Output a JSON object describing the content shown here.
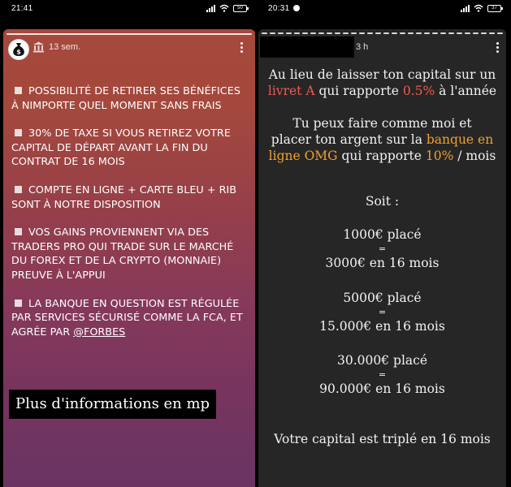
{
  "left_phone": {
    "status_time": "21:41",
    "battery": "50",
    "story_time": "13 sem.",
    "bullets": [
      "POSSIBILITÉ DE RETIRER SES BÉNÉFICES À NIMPORTE QUEL MOMENT SANS FRAIS",
      "30% DE TAXE SI VOUS RETIREZ VOTRE CAPITAL DE DÉPART AVANT LA FIN DU CONTRAT DE 16 MOIS",
      "COMPTE EN LIGNE + CARTE BLEU + RIB SONT À NOTRE DISPOSITION",
      "VOS GAINS PROVIENNENT VIA DES TRADERS PRO QUI TRADE SUR LE MARCHÉ DU FOREX ET DE LA CRYPTO (MONNAIE) PREUVE À L'APPUI",
      "LA BANQUE EN QUESTION EST RÉGULÉE PAR SERVICES SÉCURISÉ COMME LA FCA, ET AGRÉE PAR "
    ],
    "mention": "@FORBES",
    "cta": "Plus d'informations en mp",
    "colors": {
      "gradient_top": "#a4493b",
      "gradient_bottom": "#6a3462"
    }
  },
  "right_phone": {
    "status_time": "20:31",
    "battery": "37",
    "story_time": "3 h",
    "p1": {
      "a": "Au lieu de laisser ton capital sur un",
      "b1": "livret A",
      "b2": " qui rapporte ",
      "b3": "0.5%",
      "b4": " à l'année"
    },
    "p2": {
      "a": "Tu peux faire comme moi et",
      "b1": "placer ton argent sur la ",
      "b2": "banque en",
      "c1": "ligne OMG",
      "c2": " qui rapporte ",
      "c3": "10%",
      "c4": " / mois"
    },
    "soit": "Soit :",
    "examples": [
      {
        "placed": "1000€ placé",
        "eq": "=",
        "result": "3000€ en 16 mois"
      },
      {
        "placed": "5000€ placé",
        "eq": "=",
        "result": "15.000€ en 16 mois"
      },
      {
        "placed": "30.000€ placé",
        "eq": "=",
        "result": "90.000€ en 16 mois"
      }
    ],
    "conclusion": "Votre capital est triplé en 16 mois",
    "colors": {
      "background": "#262626",
      "highlight_red": "#ef5a52",
      "highlight_orange": "#f0a030"
    }
  }
}
